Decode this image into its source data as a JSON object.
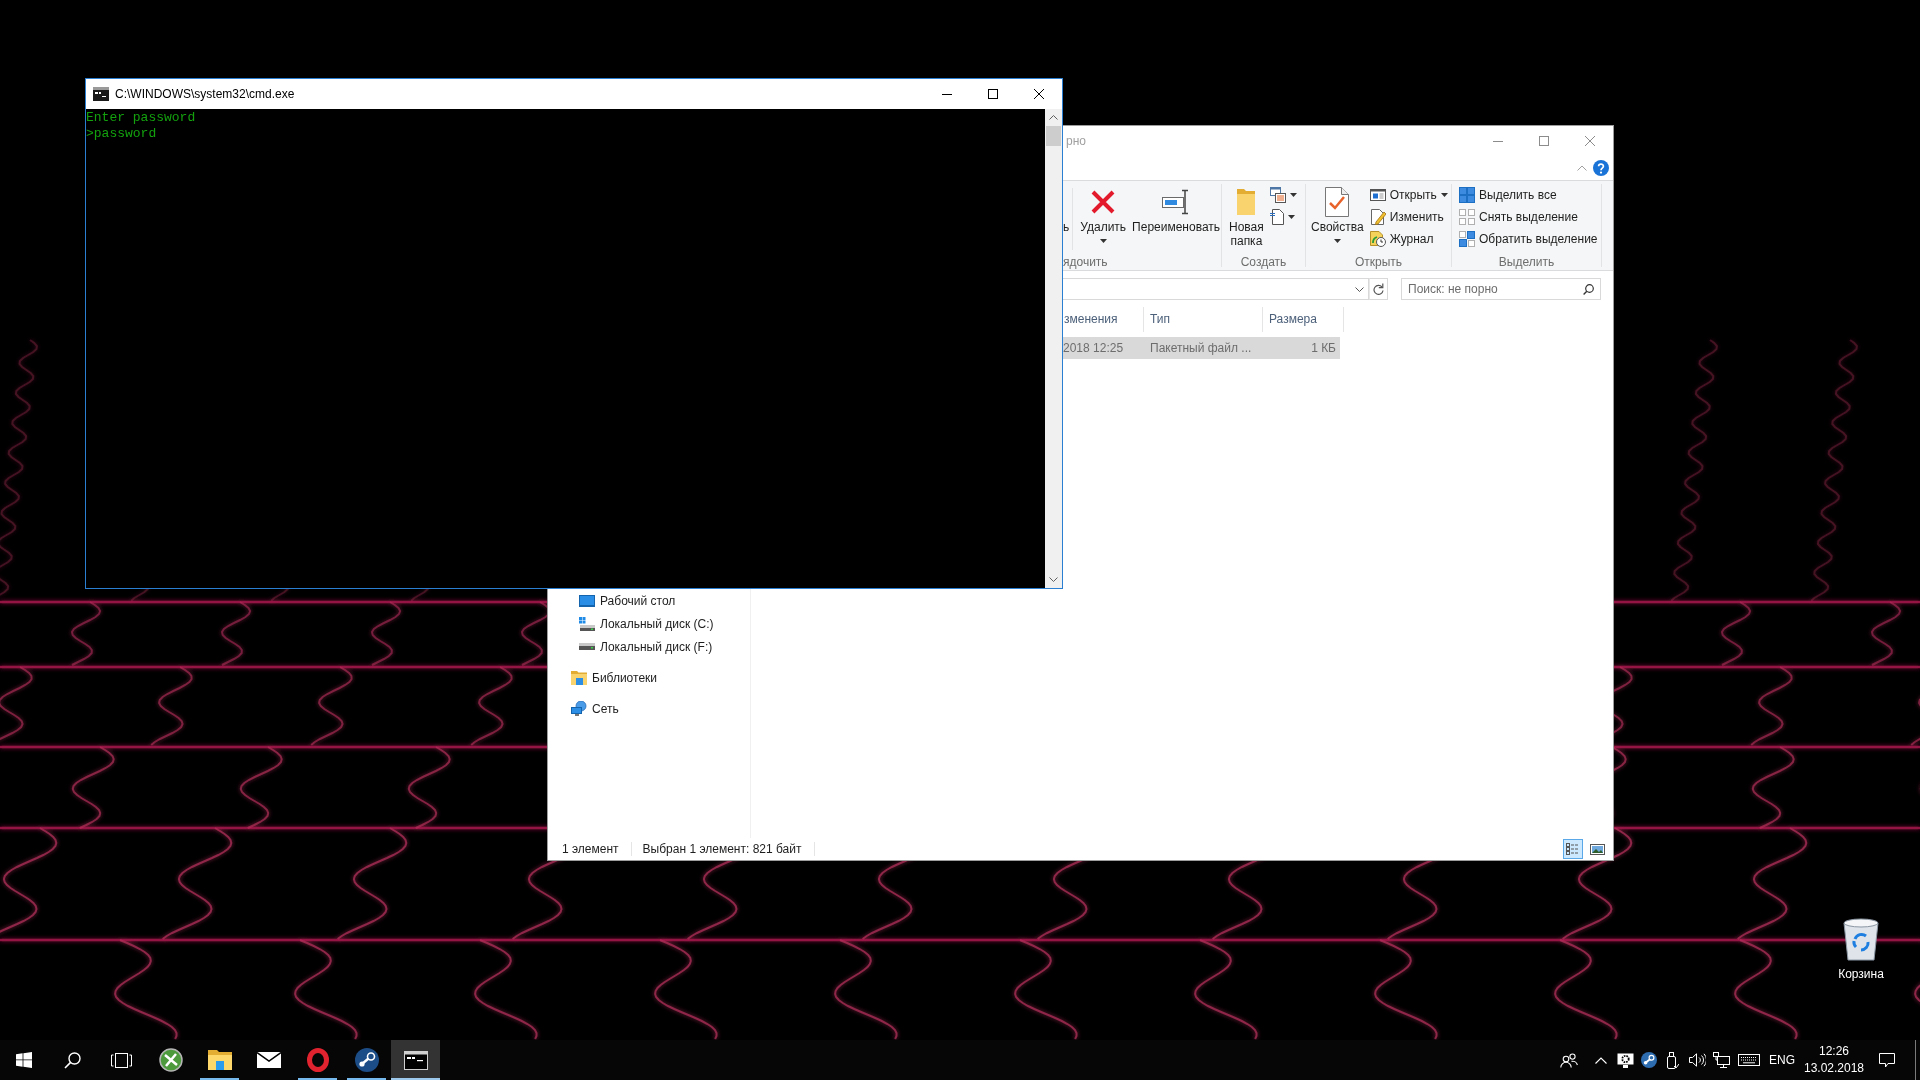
{
  "cmd_window": {
    "title": "C:\\WINDOWS\\system32\\cmd.exe",
    "lines": [
      "Enter password",
      ">password"
    ]
  },
  "explorer_window": {
    "title": "рно",
    "ribbon": {
      "groups": [
        {
          "label": "ядочить",
          "buttons": [
            "ь",
            "Удалить",
            "Переименовать"
          ]
        },
        {
          "label": "Создать",
          "buttons": [
            "Новая папка"
          ]
        },
        {
          "label": "Открыть",
          "buttons": [
            "Свойства",
            "Открыть",
            "Изменить",
            "Журнал"
          ]
        },
        {
          "label": "Выделить",
          "buttons": [
            "Выделить все",
            "Снять выделение",
            "Обратить выделение"
          ]
        }
      ]
    },
    "search": {
      "placeholder": "Поиск: не порно"
    },
    "columns": [
      "зменения",
      "Тип",
      "Размера"
    ],
    "rows": [
      {
        "cells": [
          "2018 12:25",
          "Пакетный файл ...",
          "1 КБ"
        ],
        "selected": true
      }
    ],
    "nav_pane": {
      "items": [
        {
          "children": [
            {
              "kind": "desktop",
              "label": "Рабочий стол"
            },
            {
              "kind": "system_drive",
              "label": "Локальный диск (C:)"
            },
            {
              "kind": "drive",
              "label": "Локальный диск (F:)"
            }
          ]
        },
        {
          "kind": "library",
          "label": "Библиотеки"
        },
        {
          "kind": "network",
          "label": "Сеть"
        }
      ]
    },
    "status_bar": [
      "1 элемент",
      "Выбран 1 элемент: 821 байт"
    ],
    "view_buttons": [
      {
        "selected": true
      },
      {
        "selected": false
      }
    ]
  },
  "desktop_icons": [
    {
      "label": "Корзина"
    }
  ],
  "taskbar": {
    "apps": [
      {
        "running": false,
        "selected": false
      },
      {
        "running": true,
        "selected": false
      },
      {
        "running": false,
        "selected": false
      },
      {
        "running": true,
        "selected": false
      },
      {
        "running": true,
        "selected": false
      },
      {
        "running": true,
        "selected": true
      }
    ],
    "tray": {
      "language": "ENG",
      "time": "12:26",
      "date": "13.02.2018"
    }
  }
}
